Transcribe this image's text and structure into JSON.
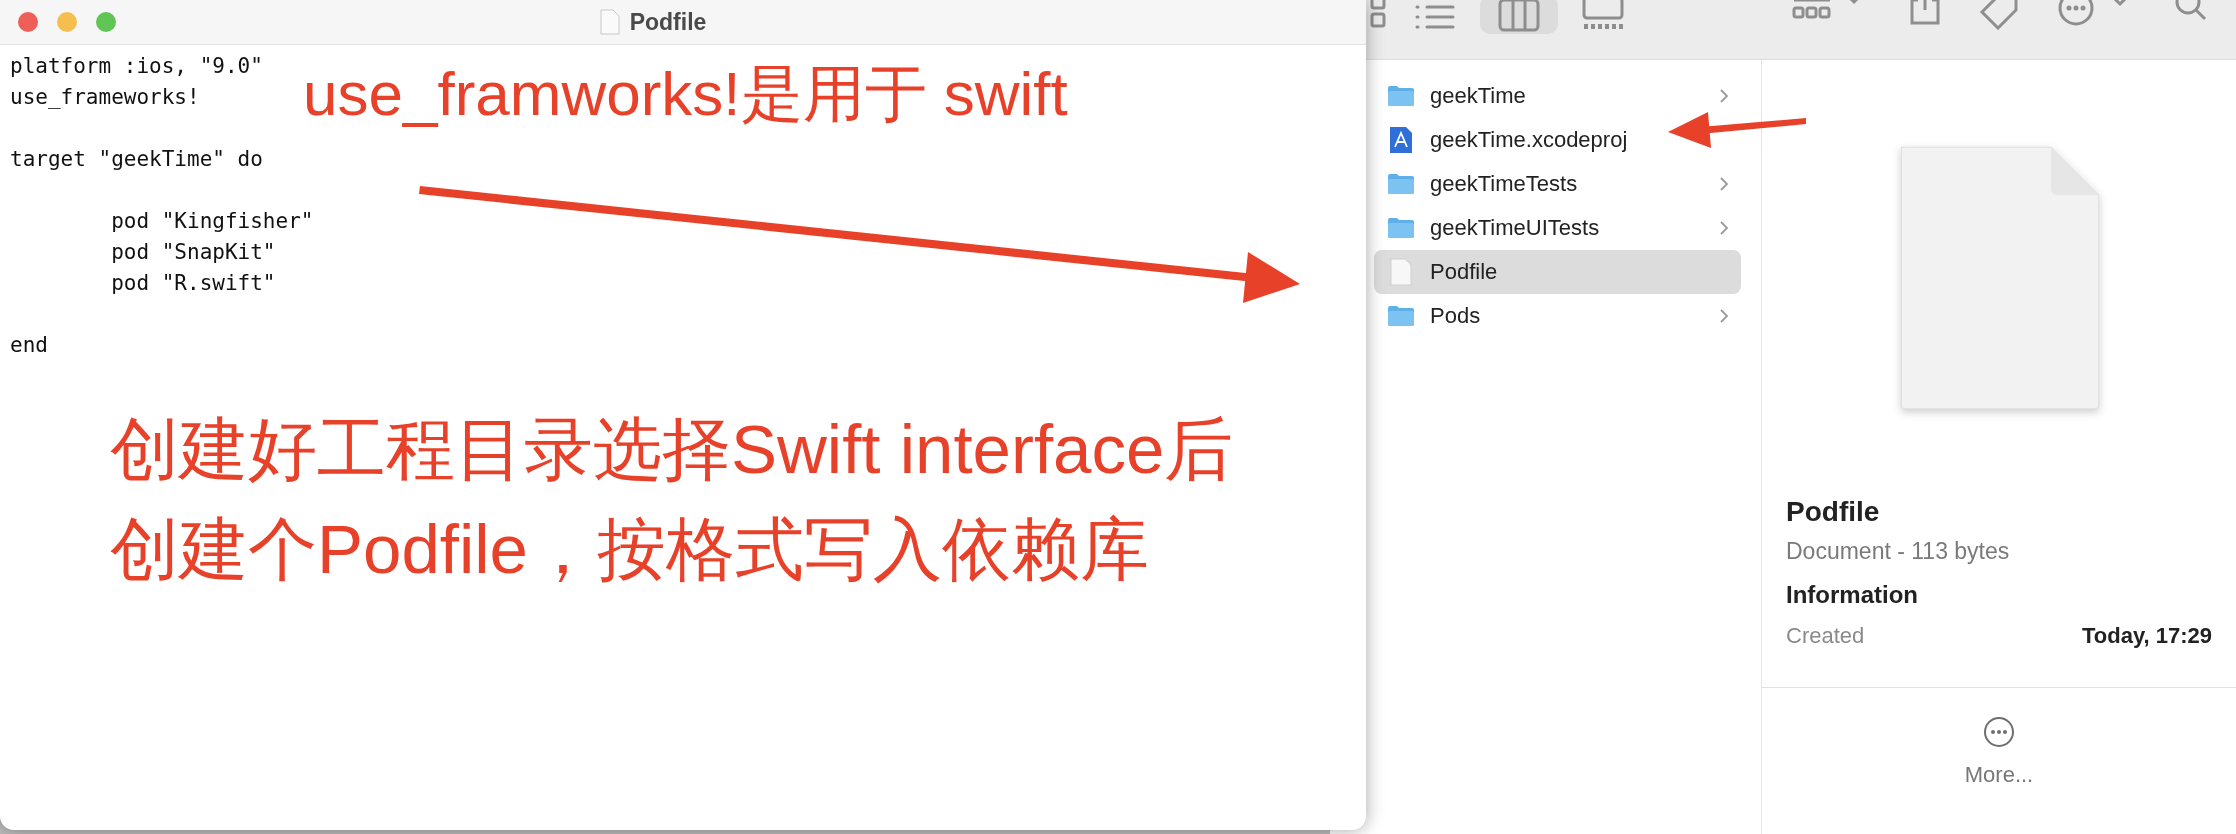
{
  "editor": {
    "title": "Podfile",
    "blocks": [
      [
        "platform :ios, \"9.0\"",
        "use_frameworks!"
      ],
      [
        "target \"geekTime\" do"
      ],
      [
        "\tpod \"Kingfisher\"",
        "\tpod \"SnapKit\"",
        "\tpod \"R.swift\""
      ],
      [
        "end"
      ]
    ]
  },
  "finder": {
    "view_modes": [
      {
        "selected": false
      },
      {
        "selected": false
      },
      {
        "selected": true
      },
      {
        "selected": false
      }
    ],
    "files": [
      {
        "name": "geekTime",
        "kind": "folder",
        "selected": false
      },
      {
        "name": "geekTime.xcodeproj",
        "kind": "project",
        "selected": false
      },
      {
        "name": "geekTimeTests",
        "kind": "folder",
        "selected": false
      },
      {
        "name": "geekTimeUITests",
        "kind": "folder",
        "selected": false
      },
      {
        "name": "Podfile",
        "kind": "document",
        "selected": true
      },
      {
        "name": "Pods",
        "kind": "folder",
        "selected": false
      }
    ],
    "preview": {
      "name": "Podfile",
      "subtitle": "Document - 113 bytes",
      "section": "Information",
      "rows": [
        {
          "label": "Created",
          "value": "Today, 17:29"
        }
      ],
      "more": "More..."
    }
  },
  "annotations": {
    "note": "use_framworks!是用于 swift",
    "caption": [
      "创建好工程目录选择Swift interface后",
      "创建个Podfile，按格式写入依赖库"
    ]
  }
}
